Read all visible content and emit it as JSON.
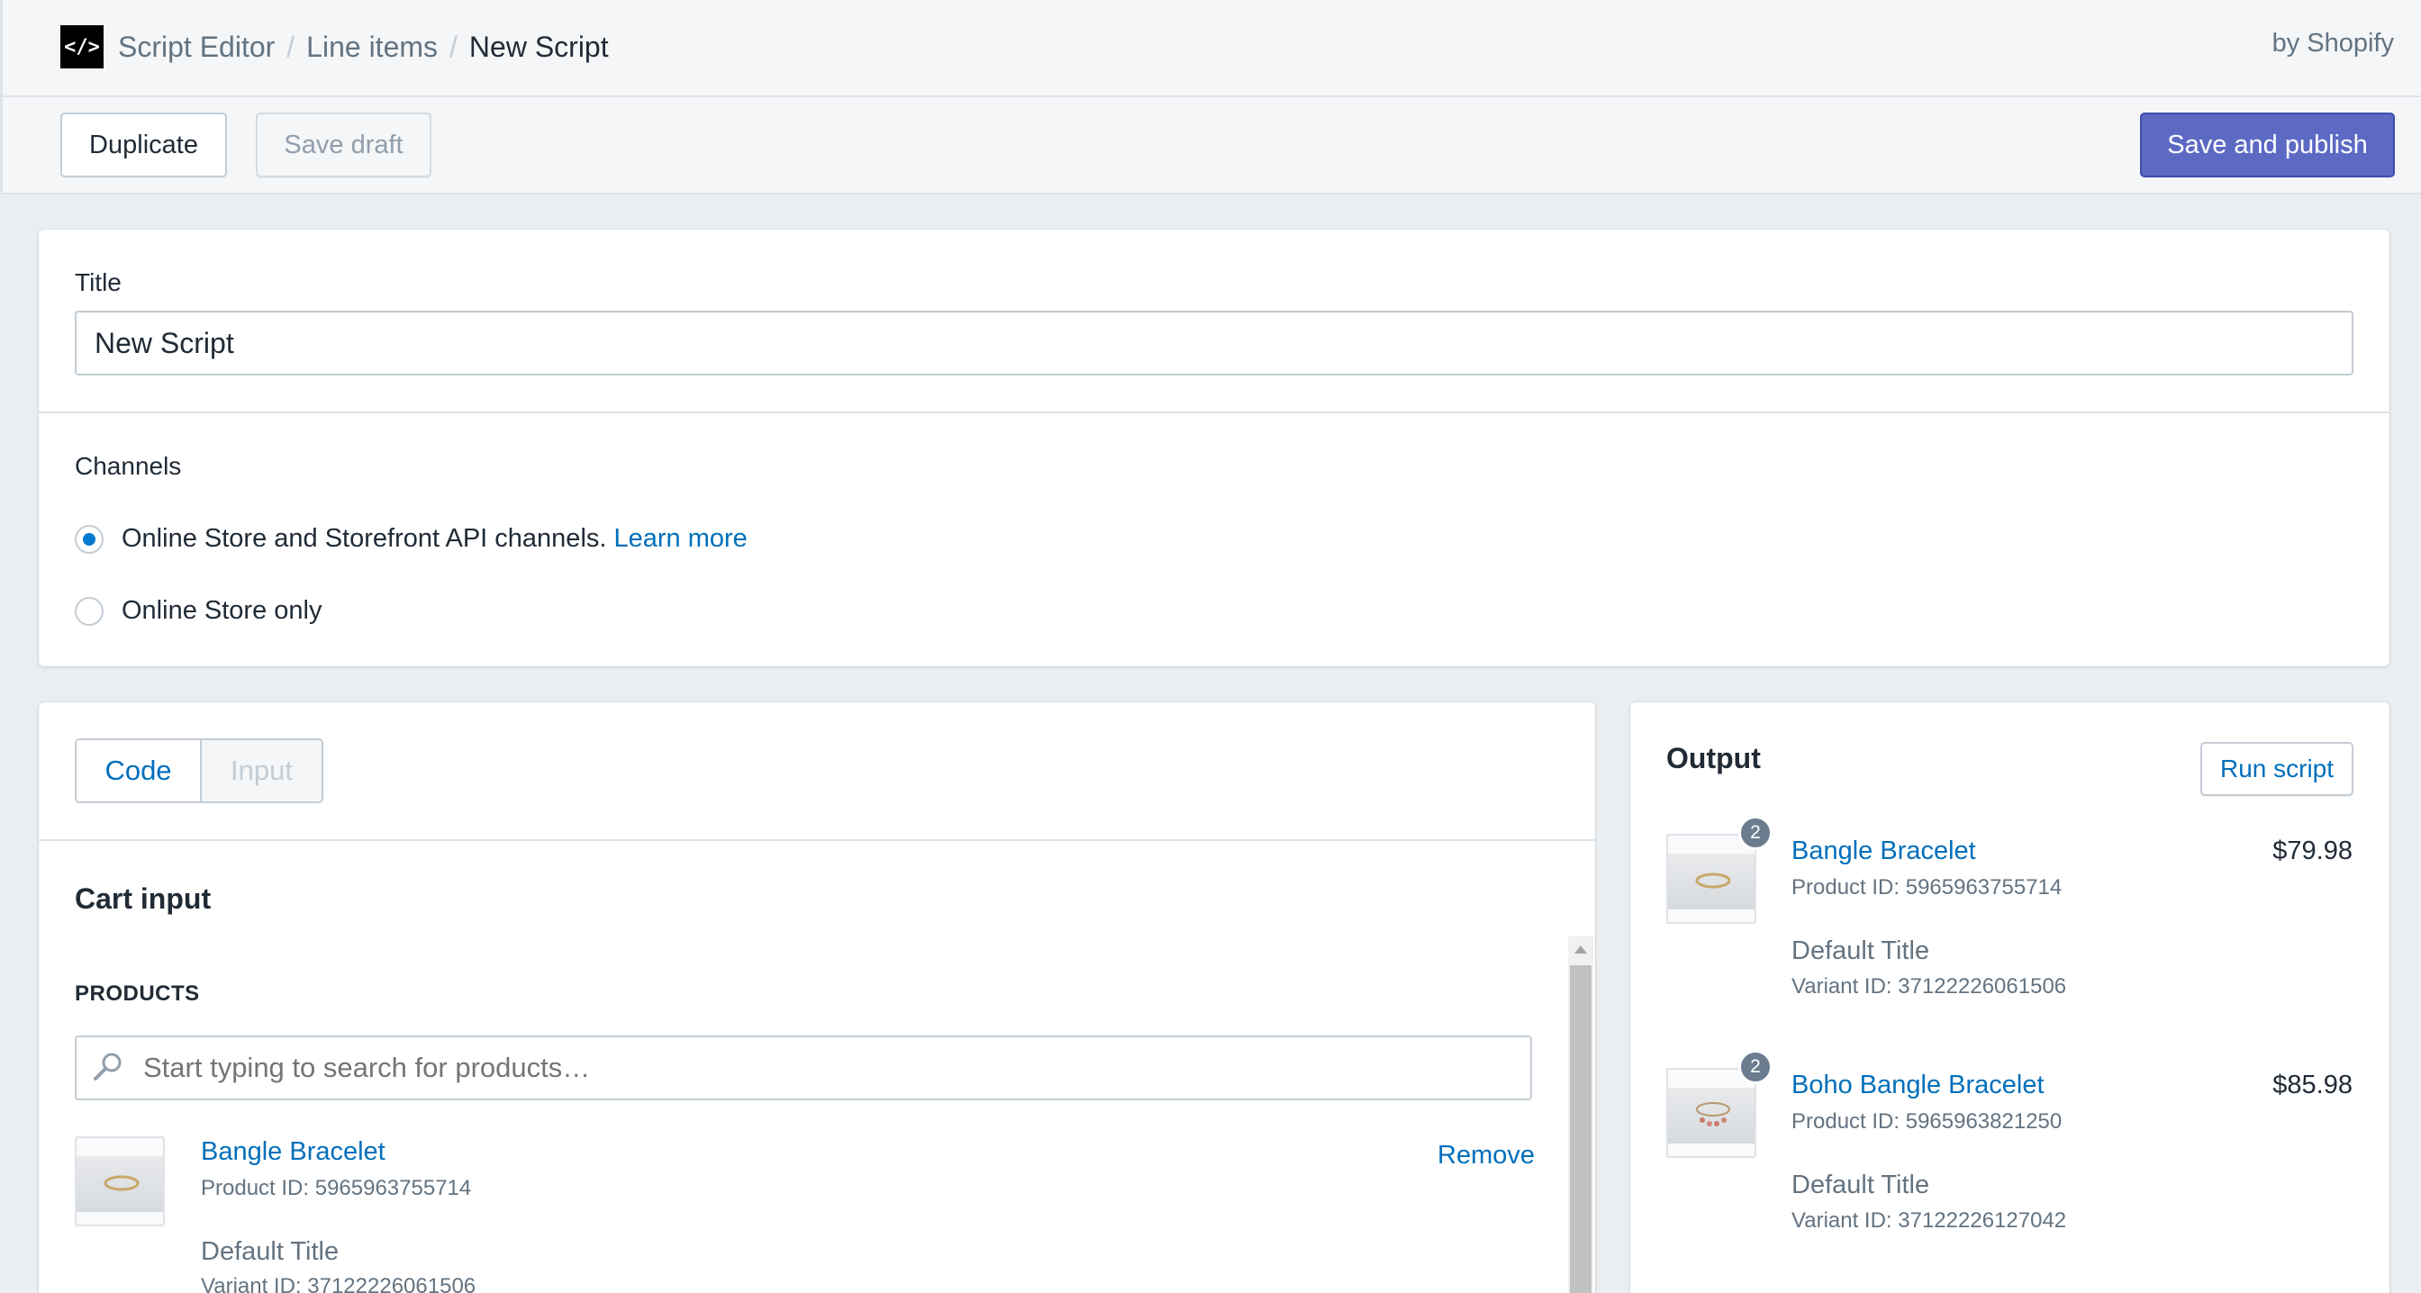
{
  "app": {
    "breadcrumb": [
      "Script Editor",
      "Line items",
      "New Script"
    ],
    "by_label": "by Shopify",
    "logo_glyph": "</>"
  },
  "toolbar": {
    "duplicate_label": "Duplicate",
    "save_draft_label": "Save draft",
    "publish_label": "Save and publish"
  },
  "form": {
    "title_label": "Title",
    "title_value": "New Script",
    "channels_label": "Channels",
    "channel_options": [
      {
        "label": "Online Store and Storefront API channels.",
        "link": "Learn more",
        "selected": true
      },
      {
        "label": "Online Store only",
        "selected": false
      }
    ]
  },
  "editor": {
    "tabs": [
      {
        "label": "Code",
        "active": true
      },
      {
        "label": "Input",
        "active": false
      }
    ],
    "cart_heading": "Cart input",
    "products_heading": "PRODUCTS",
    "search_placeholder": "Start typing to search for products…",
    "products": [
      {
        "name": "Bangle Bracelet",
        "product_id": "Product ID: 5965963755714",
        "variant_title": "Default Title",
        "variant_id": "Variant ID: 37122226061506",
        "remove_label": "Remove"
      }
    ]
  },
  "output": {
    "heading": "Output",
    "run_label": "Run script",
    "items": [
      {
        "quantity": "2",
        "name": "Bangle Bracelet",
        "product_id": "Product ID: 5965963755714",
        "variant_title": "Default Title",
        "variant_id": "Variant ID: 37122226061506",
        "price": "$79.98"
      },
      {
        "quantity": "2",
        "name": "Boho Bangle Bracelet",
        "product_id": "Product ID: 5965963821250",
        "variant_title": "Default Title",
        "variant_id": "Variant ID: 37122226127042",
        "price": "$85.98"
      }
    ]
  },
  "colors": {
    "accent": "#5c6ac4",
    "link": "#006fbb",
    "radio_selected": "#007ace",
    "badge": "#6b7c8f"
  },
  "icons": [
    "code-icon",
    "search-icon",
    "scroll-up-arrow-icon"
  ]
}
